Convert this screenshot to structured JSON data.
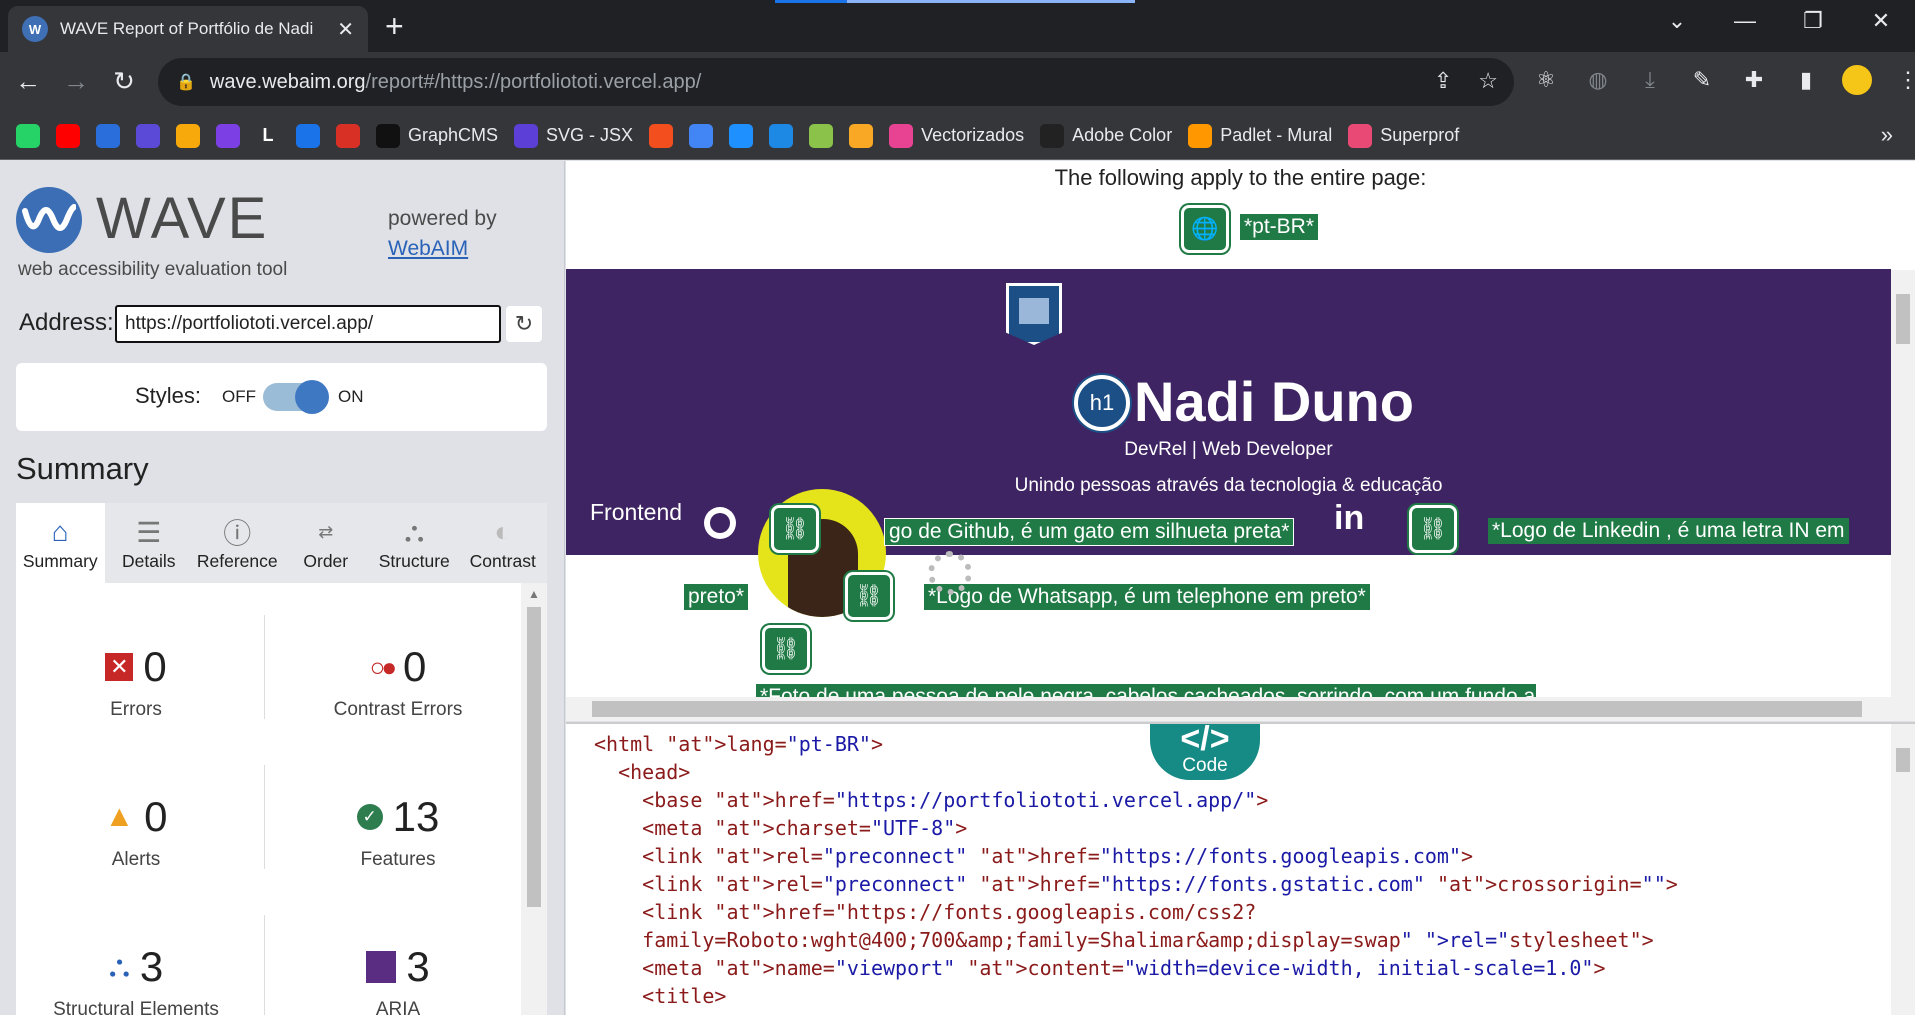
{
  "browser": {
    "tab_title": "WAVE Report of Portfólio de Nadi",
    "tab_favicon": "wave-favicon",
    "url_host": "wave.webaim.org",
    "url_path": "/report#/https://portfoliototi.vercel.app/",
    "bookmarks": [
      {
        "label": "",
        "icon": "whatsapp-icon",
        "color": "#25d366"
      },
      {
        "label": "",
        "icon": "youtube-icon",
        "color": "#ff0000"
      },
      {
        "label": "",
        "icon": "sweetalert-icon",
        "color": "#2a6edc"
      },
      {
        "label": "",
        "icon": "star-icon",
        "color": "#5b4ad8"
      },
      {
        "label": "",
        "icon": "folder-icon",
        "color": "#f7a80b"
      },
      {
        "label": "",
        "icon": "u-icon",
        "color": "#7b3fe4"
      },
      {
        "label": "L",
        "icon": "l-icon",
        "color": "#35363a"
      },
      {
        "label": "",
        "icon": "arrows-icon",
        "color": "#1a73e8"
      },
      {
        "label": "",
        "icon": "heart-icon",
        "color": "#d93025"
      },
      {
        "label": "GraphCMS",
        "icon": "graphcms-icon",
        "color": "#111111"
      },
      {
        "label": "SVG - JSX",
        "icon": "svg-jsx-icon",
        "color": "#5b3fd6"
      },
      {
        "label": "",
        "icon": "figma-icon",
        "color": "#f24e1e"
      },
      {
        "label": "",
        "icon": "c-icon",
        "color": "#4285f4"
      },
      {
        "label": "",
        "icon": "compass-icon",
        "color": "#1e90ff"
      },
      {
        "label": "",
        "icon": "grid-icon",
        "color": "#1e88e5"
      },
      {
        "label": "",
        "icon": "money-icon",
        "color": "#8bc34a"
      },
      {
        "label": "",
        "icon": "bolt-icon",
        "color": "#f9a825"
      },
      {
        "label": "Vectorizados",
        "icon": "vectorizados-icon",
        "color": "#e84393"
      },
      {
        "label": "Adobe Color",
        "icon": "adobe-color-icon",
        "color": "#222222"
      },
      {
        "label": "Padlet - Mural",
        "icon": "padlet-icon",
        "color": "#ff9800"
      },
      {
        "label": "Superprof",
        "icon": "superprof-icon",
        "color": "#e84a75"
      }
    ]
  },
  "wave": {
    "title": "WAVE",
    "subtitle": "web accessibility evaluation tool",
    "powered_by": "powered by",
    "webaim": "WebAIM",
    "address_label": "Address:",
    "address_value": "https://portfoliototi.vercel.app/",
    "styles_label": "Styles:",
    "styles_off": "OFF",
    "styles_on": "ON",
    "styles_state": "on",
    "summary_heading": "Summary",
    "tabs": [
      {
        "label": "Summary",
        "icon": "home-icon",
        "active": true
      },
      {
        "label": "Details",
        "icon": "list-icon",
        "active": false
      },
      {
        "label": "Reference",
        "icon": "info-icon",
        "active": false
      },
      {
        "label": "Order",
        "icon": "order-icon",
        "active": false
      },
      {
        "label": "Structure",
        "icon": "structure-icon",
        "active": false
      },
      {
        "label": "Contrast",
        "icon": "contrast-icon",
        "active": false
      }
    ],
    "stats": {
      "errors": {
        "value": "0",
        "label": "Errors"
      },
      "contrast_errors": {
        "value": "0",
        "label": "Contrast Errors"
      },
      "alerts": {
        "value": "0",
        "label": "Alerts"
      },
      "features": {
        "value": "13",
        "label": "Features"
      },
      "structural": {
        "value": "3",
        "label": "Structural Elements"
      },
      "aria": {
        "value": "3",
        "label": "ARIA"
      }
    }
  },
  "preview": {
    "apply_text": "The following apply to the entire page:",
    "lang_label": "*pt-BR*",
    "name": "Nadi Duno",
    "h1_badge": "h1",
    "role": "DevRel | Web Developer",
    "tagline": "Unindo pessoas através da tecnologia & educação",
    "frontend": "Frontend",
    "linkedin_text": "in",
    "github_alt": "*Logo de Github, é um gato em silhueta preta*",
    "github_alt_visible": "go de Github, é um gato em silhueta preta*",
    "linkedin_alt": "*Logo de Linkedin , é uma letra IN em",
    "linkedin_alt_cont": "preto*",
    "whatsapp_alt": "*Logo de Whatsapp, é um telephone em preto*",
    "photo_alt_partial": "*Foto de uma pessoa de pele negra, cabelos cacheados, sorrindo, com um fundo amarelo*"
  },
  "code": {
    "toggle_label": "Code",
    "lines": [
      "<html lang=\"pt-BR\">",
      "  <head>",
      "    <base href=\"https://portfoliototi.vercel.app/\">",
      "    <meta charset=\"UTF-8\">",
      "    <link rel=\"preconnect\" href=\"https://fonts.googleapis.com\">",
      "    <link rel=\"preconnect\" href=\"https://fonts.gstatic.com\" crossorigin=\"\">",
      "    <link href=\"https://fonts.googleapis.com/css2?",
      "    family=Roboto:wght@400;700&amp;family=Shalimar&amp;display=swap\" rel=\"stylesheet\">",
      "    <meta name=\"viewport\" content=\"width=device-width, initial-scale=1.0\">",
      "    <title>"
    ]
  }
}
